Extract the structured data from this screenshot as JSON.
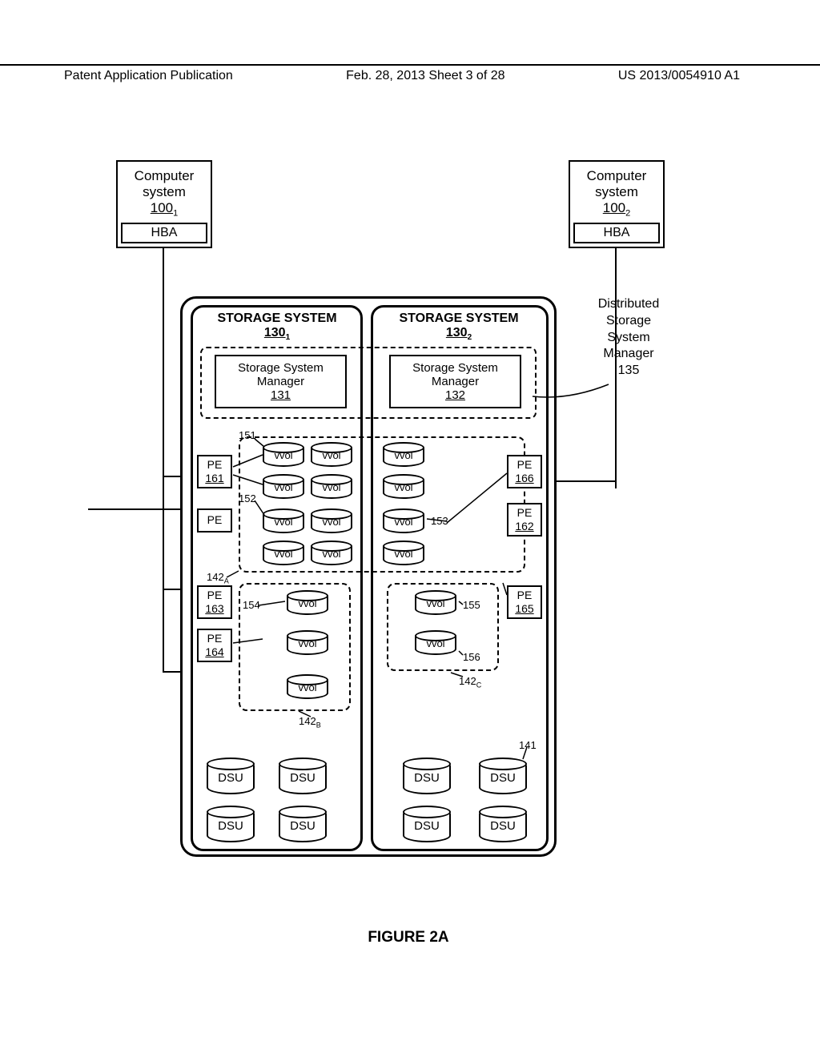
{
  "header": {
    "left": "Patent Application Publication",
    "center": "Feb. 28, 2013   Sheet 3 of 28",
    "right": "US 2013/0054910 A1"
  },
  "comp1": {
    "l1": "Computer",
    "l2": "system",
    "ref": "100",
    "sub": "1",
    "hba": "HBA"
  },
  "comp2": {
    "l1": "Computer",
    "l2": "system",
    "ref": "100",
    "sub": "2",
    "hba": "HBA"
  },
  "ss1": {
    "title": "STORAGE SYSTEM",
    "ref": "130",
    "sub": "1"
  },
  "ss2": {
    "title": "STORAGE SYSTEM",
    "ref": "130",
    "sub": "2"
  },
  "ssm1": {
    "l1": "Storage System",
    "l2": "Manager",
    "ref": "131"
  },
  "ssm2": {
    "l1": "Storage System",
    "l2": "Manager",
    "ref": "132"
  },
  "dist": {
    "l1": "Distributed",
    "l2": "Storage",
    "l3": "System",
    "l4": "Manager",
    "ref": "135"
  },
  "pe": {
    "label": "PE",
    "r161": "161",
    "r162": "162",
    "r163": "163",
    "r164": "164",
    "r165": "165",
    "r166": "166"
  },
  "vvol": "vvol",
  "dsu": "DSU",
  "refs": {
    "r151": "151",
    "r152": "152",
    "r153": "153",
    "r154": "154",
    "r155": "155",
    "r156": "156",
    "r141": "141",
    "r142A": "142",
    "r142A_sub": "A",
    "r142B": "142",
    "r142B_sub": "B",
    "r142C": "142",
    "r142C_sub": "C"
  },
  "caption": "FIGURE 2A"
}
